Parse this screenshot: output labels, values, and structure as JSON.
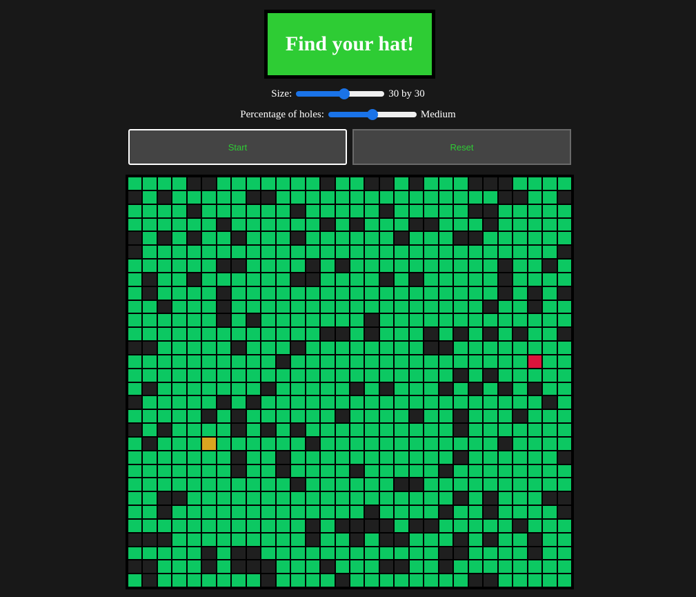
{
  "title": "Find your hat!",
  "controls": {
    "size": {
      "label": "Size:",
      "value_text": "30 by 30",
      "min": 5,
      "max": 50,
      "value": 30
    },
    "holes": {
      "label": "Percentage of holes:",
      "value_text": "Medium",
      "min": 1,
      "max": 5,
      "value": 3
    }
  },
  "buttons": {
    "start": "Start",
    "reset": "Reset"
  },
  "colors": {
    "background": "#181818",
    "title_bg": "#2ecc34",
    "field": "#0cc862",
    "hole": "#1f1f1f",
    "hat": "#daa520",
    "player": "#dc143c",
    "button_text": "#2ecc34"
  },
  "board": {
    "rows": 30,
    "cols": 30,
    "player": {
      "row": 13,
      "col": 27
    },
    "hat": {
      "row": 19,
      "col": 5
    },
    "holes": [
      [
        4,
        5,
        13,
        16,
        17,
        19,
        23,
        24,
        25
      ],
      [
        0,
        2,
        8,
        9,
        25,
        26,
        29
      ],
      [
        4,
        11,
        17,
        23,
        24
      ],
      [
        6,
        13,
        15,
        19,
        20,
        24
      ],
      [
        0,
        2,
        4,
        7,
        11,
        18,
        22,
        23
      ],
      [
        0,
        29
      ],
      [
        6,
        7,
        12,
        14,
        25,
        28
      ],
      [
        1,
        4,
        11,
        12,
        17,
        19,
        25
      ],
      [
        1,
        6,
        25,
        27,
        29
      ],
      [
        2,
        6,
        24,
        27
      ],
      [
        6,
        8,
        16
      ],
      [
        13,
        14,
        16,
        20,
        22,
        24,
        26,
        29
      ],
      [
        0,
        1,
        7,
        11,
        20,
        21
      ],
      [
        10,
        27
      ],
      [
        22,
        24
      ],
      [
        1,
        9,
        15,
        17,
        21,
        23,
        25,
        27
      ],
      [
        0,
        6,
        8,
        28
      ],
      [
        5,
        7,
        14,
        19,
        22,
        26
      ],
      [
        0,
        2,
        7,
        9,
        11,
        22
      ],
      [
        1,
        12,
        25
      ],
      [
        7,
        10,
        22,
        29
      ],
      [
        7,
        10,
        15,
        21
      ],
      [
        11,
        18,
        19
      ],
      [
        2,
        3,
        22,
        24,
        28,
        29
      ],
      [
        2,
        16,
        21,
        24,
        29
      ],
      [
        12,
        14,
        15,
        16,
        17,
        19,
        20,
        26
      ],
      [
        0,
        1,
        2,
        12,
        15,
        17,
        18,
        22,
        24,
        27
      ],
      [
        5,
        7,
        8,
        21,
        22,
        27
      ],
      [
        0,
        1,
        5,
        7,
        8,
        9,
        13,
        17,
        18,
        21
      ],
      [
        1,
        9,
        14,
        23,
        24
      ]
    ]
  }
}
